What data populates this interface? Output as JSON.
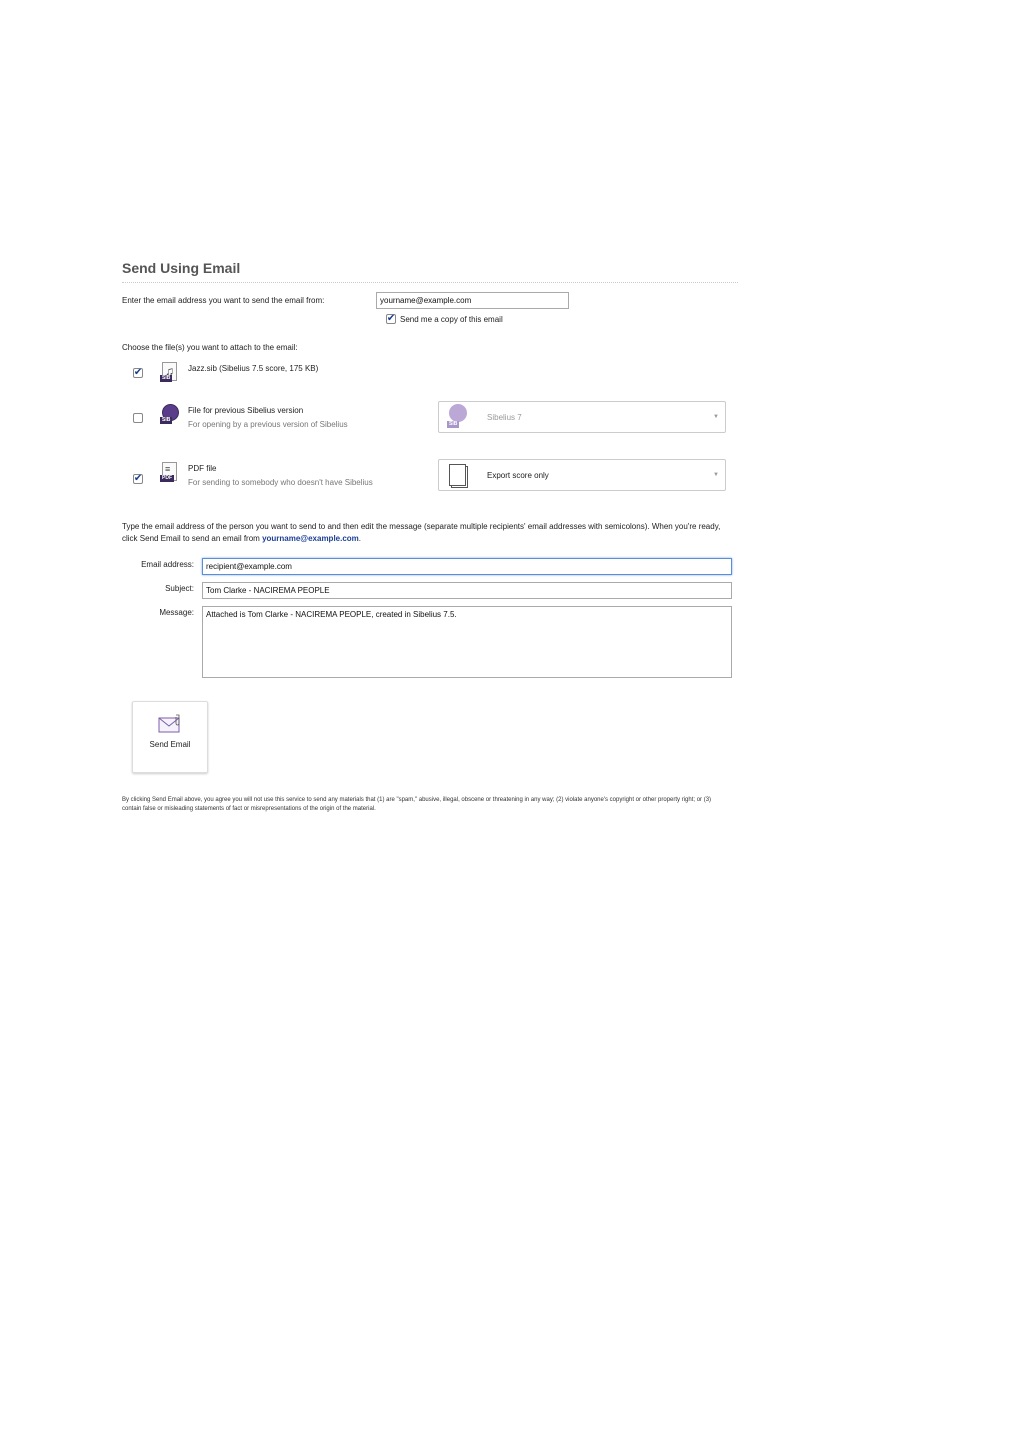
{
  "panel": {
    "title": "Send Using Email",
    "from_label": "Enter the email address you want to send the email from:",
    "from_value": "yourname@example.com",
    "copy_checked": true,
    "copy_label": "Send me a copy of this email",
    "choose_label": "Choose the file(s) you want to attach to the email:"
  },
  "files": [
    {
      "checked": true,
      "icon": "sib-score-icon",
      "tag": "SIB",
      "title": "Jazz.sib (Sibelius 7.5 score, 175 KB)",
      "subtitle": ""
    },
    {
      "checked": false,
      "icon": "sib-previous-version-icon",
      "tag": "SIB",
      "title": "File for previous Sibelius version",
      "subtitle": "For opening by a previous version of Sibelius",
      "dropdown": {
        "value": "Sibelius 7",
        "icon": "sib-version-icon",
        "disabled": true
      }
    },
    {
      "checked": true,
      "icon": "pdf-file-icon",
      "tag": "PDF",
      "title": "PDF file",
      "subtitle": "For sending to somebody who doesn't have Sibelius",
      "dropdown": {
        "value": "Export score only",
        "icon": "pages-icon",
        "disabled": false
      }
    }
  ],
  "instructions": {
    "text": "Type the email address of the person you want to send to and then edit the message (separate multiple recipients' email addresses with semicolons). When you're ready, click Send Email to send an email from ",
    "link": "yourname@example.com",
    "end": "."
  },
  "form": {
    "email_label": "Email address:",
    "email_value": "recipient@example.com",
    "subject_label": "Subject:",
    "subject_value": "Tom Clarke - NACIREMA PEOPLE",
    "message_label": "Message:",
    "message_value": "Attached is Tom Clarke - NACIREMA PEOPLE, created in Sibelius 7.5."
  },
  "send_button": {
    "label": "Send Email",
    "icon": "envelope-icon"
  },
  "legal": "By clicking Send Email above, you agree you will not use this service to send any materials that (1) are \"spam,\" abusive, illegal, obscene or threatening in any way; (2) violate anyone's copyright or other property right; or (3) contain false or misleading statements of fact or misrepresentations of the origin of the material.",
  "colors": {
    "link": "#1c3f94",
    "accent": "#3b2b5c",
    "focus": "#5a8fd8"
  }
}
